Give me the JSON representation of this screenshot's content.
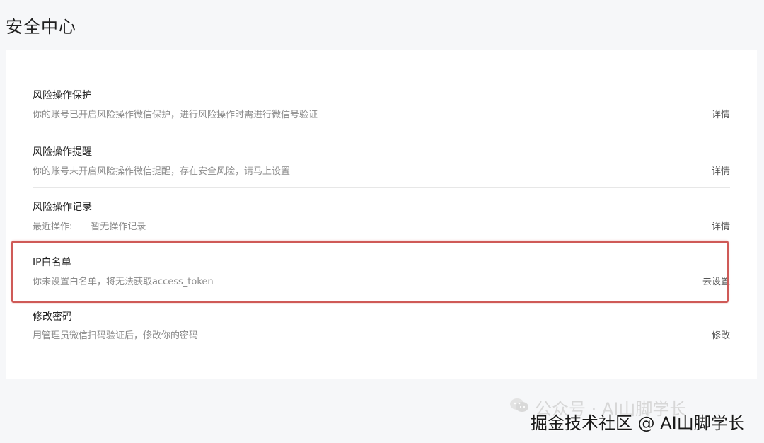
{
  "page": {
    "title": "安全中心"
  },
  "items": [
    {
      "title": "风险操作保护",
      "desc": "你的账号已开启风险操作微信保护，进行风险操作时需进行微信号验证",
      "action": "详情"
    },
    {
      "title": "风险操作提醒",
      "desc": "你的账号未开启风险操作微信提醒，存在安全风险，请马上设置",
      "action": "详情"
    },
    {
      "title": "风险操作记录",
      "desc_label": "最近操作:",
      "desc_value": "暂无操作记录",
      "action": "详情"
    },
    {
      "title": "IP白名单",
      "desc": "你未设置白名单，将无法获取access_token",
      "action": "去设置"
    },
    {
      "title": "修改密码",
      "desc": "用管理员微信扫码验证后，修改你的密码",
      "action": "修改"
    }
  ],
  "watermark": {
    "faint": "公众号 · AI山脚学长",
    "main": "掘金技术社区 @ AI山脚学长"
  },
  "colors": {
    "highlight": "#cf5a57",
    "background": "#f6f7f9",
    "card": "#ffffff"
  }
}
